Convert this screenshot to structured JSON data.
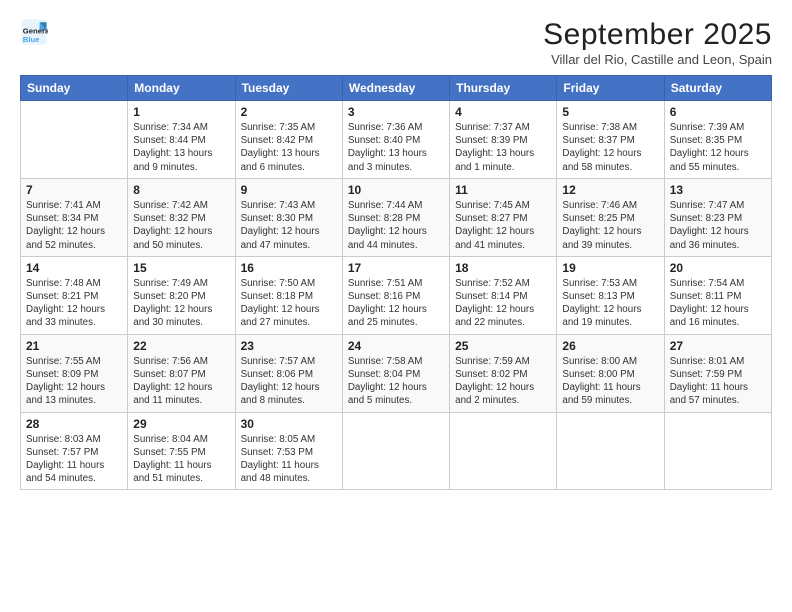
{
  "logo": {
    "line1": "General",
    "line2": "Blue"
  },
  "title": "September 2025",
  "subtitle": "Villar del Rio, Castille and Leon, Spain",
  "days_of_week": [
    "Sunday",
    "Monday",
    "Tuesday",
    "Wednesday",
    "Thursday",
    "Friday",
    "Saturday"
  ],
  "weeks": [
    [
      {
        "num": "",
        "info": ""
      },
      {
        "num": "1",
        "info": "Sunrise: 7:34 AM\nSunset: 8:44 PM\nDaylight: 13 hours\nand 9 minutes."
      },
      {
        "num": "2",
        "info": "Sunrise: 7:35 AM\nSunset: 8:42 PM\nDaylight: 13 hours\nand 6 minutes."
      },
      {
        "num": "3",
        "info": "Sunrise: 7:36 AM\nSunset: 8:40 PM\nDaylight: 13 hours\nand 3 minutes."
      },
      {
        "num": "4",
        "info": "Sunrise: 7:37 AM\nSunset: 8:39 PM\nDaylight: 13 hours\nand 1 minute."
      },
      {
        "num": "5",
        "info": "Sunrise: 7:38 AM\nSunset: 8:37 PM\nDaylight: 12 hours\nand 58 minutes."
      },
      {
        "num": "6",
        "info": "Sunrise: 7:39 AM\nSunset: 8:35 PM\nDaylight: 12 hours\nand 55 minutes."
      }
    ],
    [
      {
        "num": "7",
        "info": "Sunrise: 7:41 AM\nSunset: 8:34 PM\nDaylight: 12 hours\nand 52 minutes."
      },
      {
        "num": "8",
        "info": "Sunrise: 7:42 AM\nSunset: 8:32 PM\nDaylight: 12 hours\nand 50 minutes."
      },
      {
        "num": "9",
        "info": "Sunrise: 7:43 AM\nSunset: 8:30 PM\nDaylight: 12 hours\nand 47 minutes."
      },
      {
        "num": "10",
        "info": "Sunrise: 7:44 AM\nSunset: 8:28 PM\nDaylight: 12 hours\nand 44 minutes."
      },
      {
        "num": "11",
        "info": "Sunrise: 7:45 AM\nSunset: 8:27 PM\nDaylight: 12 hours\nand 41 minutes."
      },
      {
        "num": "12",
        "info": "Sunrise: 7:46 AM\nSunset: 8:25 PM\nDaylight: 12 hours\nand 39 minutes."
      },
      {
        "num": "13",
        "info": "Sunrise: 7:47 AM\nSunset: 8:23 PM\nDaylight: 12 hours\nand 36 minutes."
      }
    ],
    [
      {
        "num": "14",
        "info": "Sunrise: 7:48 AM\nSunset: 8:21 PM\nDaylight: 12 hours\nand 33 minutes."
      },
      {
        "num": "15",
        "info": "Sunrise: 7:49 AM\nSunset: 8:20 PM\nDaylight: 12 hours\nand 30 minutes."
      },
      {
        "num": "16",
        "info": "Sunrise: 7:50 AM\nSunset: 8:18 PM\nDaylight: 12 hours\nand 27 minutes."
      },
      {
        "num": "17",
        "info": "Sunrise: 7:51 AM\nSunset: 8:16 PM\nDaylight: 12 hours\nand 25 minutes."
      },
      {
        "num": "18",
        "info": "Sunrise: 7:52 AM\nSunset: 8:14 PM\nDaylight: 12 hours\nand 22 minutes."
      },
      {
        "num": "19",
        "info": "Sunrise: 7:53 AM\nSunset: 8:13 PM\nDaylight: 12 hours\nand 19 minutes."
      },
      {
        "num": "20",
        "info": "Sunrise: 7:54 AM\nSunset: 8:11 PM\nDaylight: 12 hours\nand 16 minutes."
      }
    ],
    [
      {
        "num": "21",
        "info": "Sunrise: 7:55 AM\nSunset: 8:09 PM\nDaylight: 12 hours\nand 13 minutes."
      },
      {
        "num": "22",
        "info": "Sunrise: 7:56 AM\nSunset: 8:07 PM\nDaylight: 12 hours\nand 11 minutes."
      },
      {
        "num": "23",
        "info": "Sunrise: 7:57 AM\nSunset: 8:06 PM\nDaylight: 12 hours\nand 8 minutes."
      },
      {
        "num": "24",
        "info": "Sunrise: 7:58 AM\nSunset: 8:04 PM\nDaylight: 12 hours\nand 5 minutes."
      },
      {
        "num": "25",
        "info": "Sunrise: 7:59 AM\nSunset: 8:02 PM\nDaylight: 12 hours\nand 2 minutes."
      },
      {
        "num": "26",
        "info": "Sunrise: 8:00 AM\nSunset: 8:00 PM\nDaylight: 11 hours\nand 59 minutes."
      },
      {
        "num": "27",
        "info": "Sunrise: 8:01 AM\nSunset: 7:59 PM\nDaylight: 11 hours\nand 57 minutes."
      }
    ],
    [
      {
        "num": "28",
        "info": "Sunrise: 8:03 AM\nSunset: 7:57 PM\nDaylight: 11 hours\nand 54 minutes."
      },
      {
        "num": "29",
        "info": "Sunrise: 8:04 AM\nSunset: 7:55 PM\nDaylight: 11 hours\nand 51 minutes."
      },
      {
        "num": "30",
        "info": "Sunrise: 8:05 AM\nSunset: 7:53 PM\nDaylight: 11 hours\nand 48 minutes."
      },
      {
        "num": "",
        "info": ""
      },
      {
        "num": "",
        "info": ""
      },
      {
        "num": "",
        "info": ""
      },
      {
        "num": "",
        "info": ""
      }
    ]
  ]
}
